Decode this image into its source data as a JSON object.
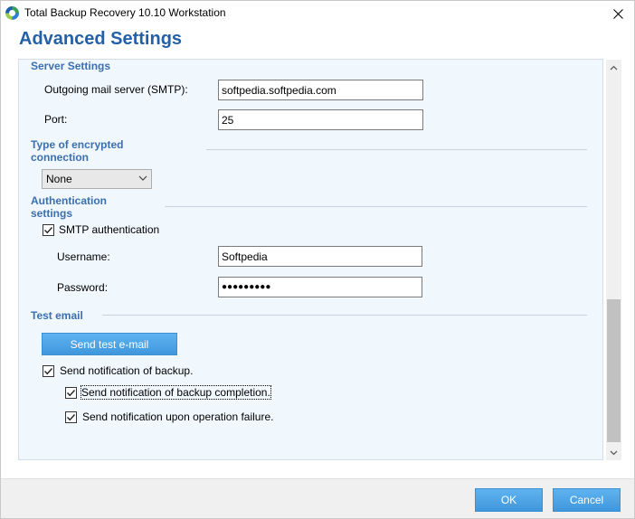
{
  "window": {
    "title": "Total Backup Recovery 10.10 Workstation"
  },
  "page": {
    "heading": "Advanced Settings"
  },
  "server": {
    "section_title": "Server Settings",
    "smtp_label": "Outgoing mail server (SMTP):",
    "smtp_value": "softpedia.softpedia.com",
    "port_label": "Port:",
    "port_value": "25"
  },
  "encryption": {
    "section_title": "Type of encrypted connection",
    "selected": "None"
  },
  "auth": {
    "section_title": "Authentication settings",
    "smtp_auth_label": "SMTP authentication",
    "smtp_auth_checked": true,
    "username_label": "Username:",
    "username_value": "Softpedia",
    "password_label": "Password:",
    "password_value": "●●●●●●●●●"
  },
  "test": {
    "section_title": "Test email",
    "send_button": "Send test e-mail"
  },
  "notifications": {
    "send_backup_label": "Send notification of backup.",
    "send_backup_checked": true,
    "completion_label": "Send notification of backup completion.",
    "completion_checked": true,
    "failure_label": "Send notification upon operation failure.",
    "failure_checked": true
  },
  "footer": {
    "ok_label": "OK",
    "cancel_label": "Cancel"
  },
  "colors": {
    "heading": "#2460a7",
    "section": "#3b6fb0",
    "button": "#4aa3e6",
    "panel_bg": "#f0f7fd"
  },
  "icons": {
    "app": "app-logo-icon",
    "close": "close-icon",
    "dropdown": "chevron-down-icon",
    "check": "checkmark-icon",
    "scroll_up": "chevron-up-icon",
    "scroll_down": "chevron-down-icon"
  }
}
